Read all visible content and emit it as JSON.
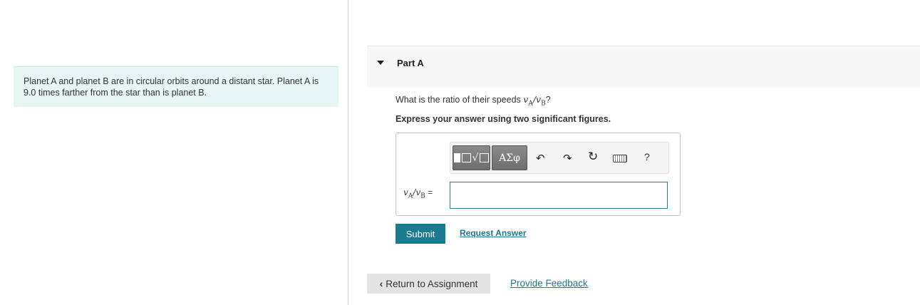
{
  "problem": {
    "text": "Planet A and planet B are in circular orbits around a distant star. Planet A is 9.0 times farther from the star than is planet B."
  },
  "part": {
    "title": "Part A",
    "question_prefix": "What is the ratio of their speeds",
    "question_suffix": "?",
    "instruction": "Express your answer using two significant figures."
  },
  "toolbar": {
    "templates_icon": "templates-icon",
    "symbols_label": "ΑΣφ",
    "undo_icon": "undo-icon",
    "redo_icon": "redo-icon",
    "reset_icon": "reset-icon",
    "keyboard_icon": "keyboard-icon",
    "help_label": "?"
  },
  "answer": {
    "label_suffix": "=",
    "value": ""
  },
  "actions": {
    "submit_label": "Submit",
    "request_answer_label": "Request Answer",
    "return_label": "Return to Assignment",
    "feedback_label": "Provide Feedback"
  },
  "colors": {
    "accent": "#1a7a8f",
    "problem_bg": "#e8f5f5"
  }
}
